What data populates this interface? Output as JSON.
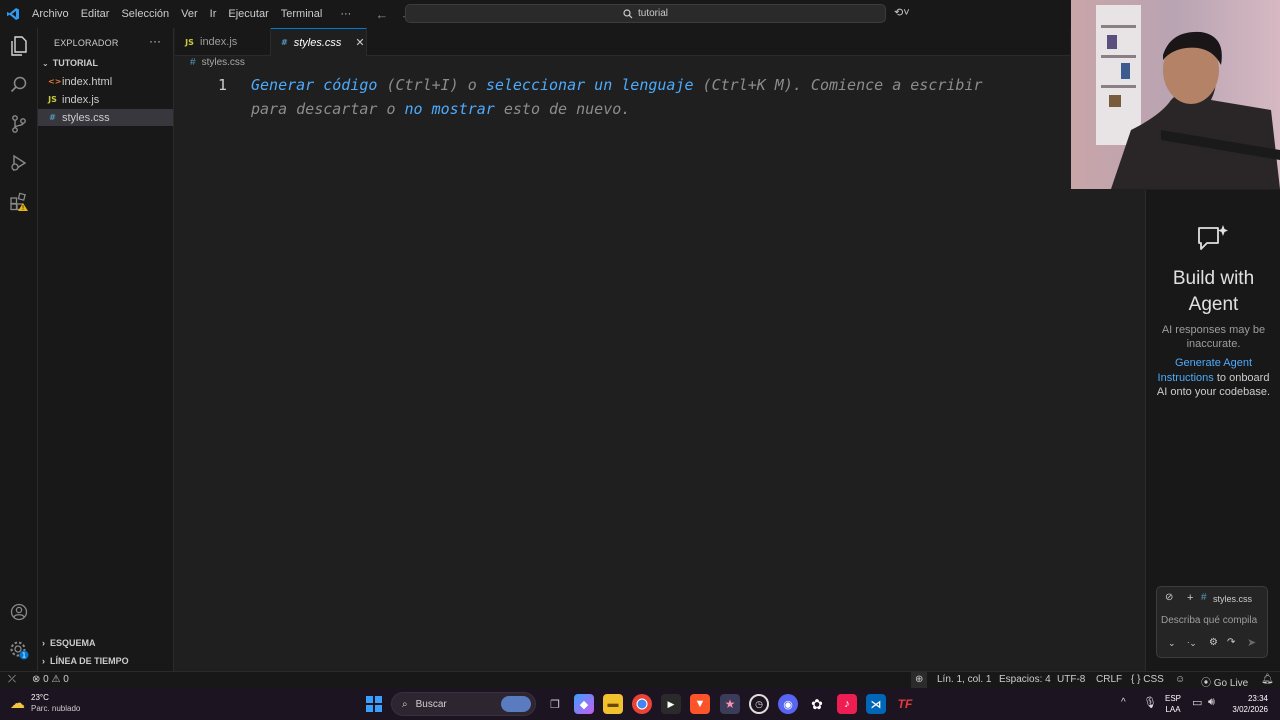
{
  "menu": [
    "Archivo",
    "Editar",
    "Selección",
    "Ver",
    "Ir",
    "Ejecutar",
    "Terminal",
    "···"
  ],
  "search": {
    "text": "tutorial"
  },
  "sidebar": {
    "title": "EXPLORADOR",
    "folder": "TUTORIAL",
    "files": [
      {
        "name": "index.html",
        "icon": "<>",
        "color": "#e37933"
      },
      {
        "name": "index.js",
        "icon": "JS",
        "color": "#cbcb41"
      },
      {
        "name": "styles.css",
        "icon": "#",
        "color": "#519aba"
      }
    ],
    "sections": [
      "ESQUEMA",
      "LÍNEA DE TIEMPO"
    ]
  },
  "tabs": [
    {
      "name": "index.js",
      "icon": "JS"
    },
    {
      "name": "styles.css",
      "icon": "#"
    }
  ],
  "breadcrumb": "styles.css",
  "editor": {
    "line_number": "1",
    "hint1_a": "Generar código",
    "hint1_b": " (Ctrl+I) o ",
    "hint1_c": "seleccionar un lenguaje",
    "hint1_d": " (Ctrl+K M). Comience a escribir",
    "hint2_a": "para descartar o ",
    "hint2_b": "no mostrar",
    "hint2_c": " esto de nuevo."
  },
  "chat": {
    "title": "Build with Agent",
    "disclaimer": "AI responses may be inaccurate.",
    "link": "Generate Agent Instructions",
    "rest": " to onboard AI onto your codebase.",
    "context_file": "styles.css",
    "placeholder": "Describa qué compila"
  },
  "status": {
    "errors": "0",
    "warnings": "0",
    "position": "Lín. 1, col. 1",
    "spaces": "Espacios: 4",
    "encoding": "UTF-8",
    "eol": "CRLF",
    "language": "CSS",
    "golive": "Go Live"
  },
  "taskbar": {
    "weather_temp": "23°C",
    "weather_desc": "Parc. nublado",
    "search": "Buscar",
    "lang1": "ESP",
    "lang2": "LAA",
    "time": "23:34",
    "date": "3/02/2026"
  }
}
